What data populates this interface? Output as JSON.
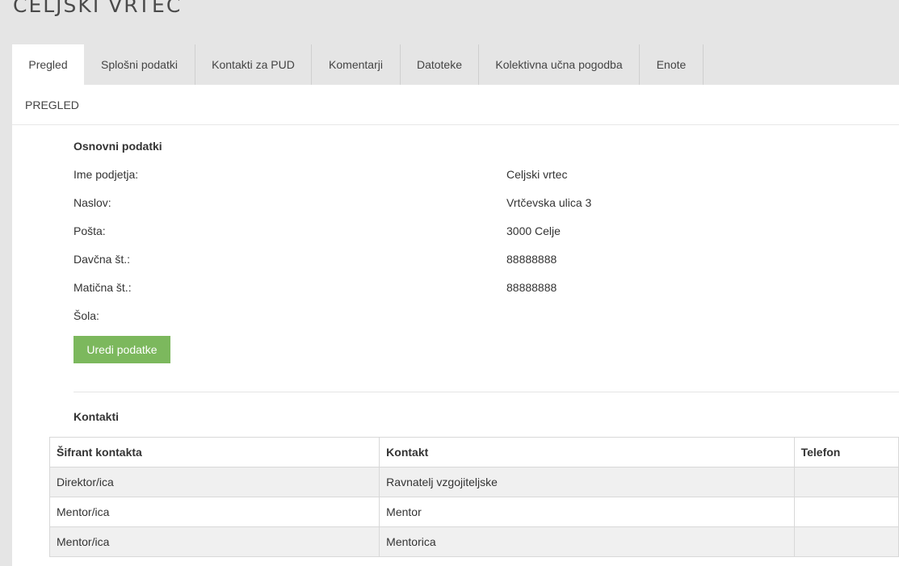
{
  "page": {
    "title": "CELJSKI VRTEC"
  },
  "tabs": [
    {
      "label": "Pregled"
    },
    {
      "label": "Splošni podatki"
    },
    {
      "label": "Kontakti za PUD"
    },
    {
      "label": "Komentarji"
    },
    {
      "label": "Datoteke"
    },
    {
      "label": "Kolektivna učna pogodba"
    },
    {
      "label": "Enote"
    }
  ],
  "panel": {
    "header": "PREGLED"
  },
  "basic": {
    "title": "Osnovni podatki",
    "fields": [
      {
        "label": "Ime podjetja:",
        "value": "Celjski vrtec"
      },
      {
        "label": "Naslov:",
        "value": "Vrtčevska ulica 3"
      },
      {
        "label": "Pošta:",
        "value": "3000 Celje"
      },
      {
        "label": "Davčna št.:",
        "value": "88888888"
      },
      {
        "label": "Matična št.:",
        "value": "88888888"
      },
      {
        "label": "Šola:",
        "value": ""
      }
    ],
    "edit_label": "Uredi podatke"
  },
  "contacts": {
    "title": "Kontakti",
    "columns": [
      "Šifrant kontakta",
      "Kontakt",
      "Telefon"
    ],
    "rows": [
      [
        "Direktor/ica",
        "Ravnatelj vzgojiteljske",
        ""
      ],
      [
        "Mentor/ica",
        "Mentor",
        ""
      ],
      [
        "Mentor/ica",
        "Mentorica",
        ""
      ]
    ]
  },
  "colors": {
    "accent_button": "#7cb85d",
    "background": "#e5e5e5"
  }
}
